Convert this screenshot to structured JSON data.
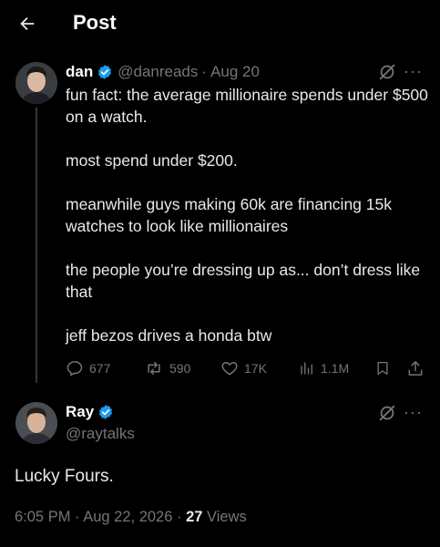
{
  "header": {
    "title": "Post",
    "back_icon": "arrow-left-icon"
  },
  "post": {
    "author_name": "dan",
    "handle": "@danreads",
    "separator": "·",
    "date": "Aug 20",
    "paragraphs": [
      "fun fact: the average millionaire spends under $500 on a watch.",
      "most spend under $200.",
      "meanwhile guys making 60k are financing 15k watches to look like millionaires",
      "the people you’re dressing up as... don’t dress like that",
      "jeff bezos drives a honda btw"
    ],
    "stats": {
      "replies": "677",
      "reposts": "590",
      "likes": "17K",
      "views": "1.1M"
    }
  },
  "reply": {
    "author_name": "Ray",
    "handle": "@raytalks",
    "text": "Lucky Fours.",
    "time": "6:05 PM",
    "sep1": "·",
    "date": "Aug 22, 2026",
    "sep2": "·",
    "views_count": "27",
    "views_label": "Views"
  },
  "colors": {
    "verified": "#1d9bf0",
    "muted": "#71767b",
    "text": "#e7e9ea",
    "bg": "#000000"
  }
}
